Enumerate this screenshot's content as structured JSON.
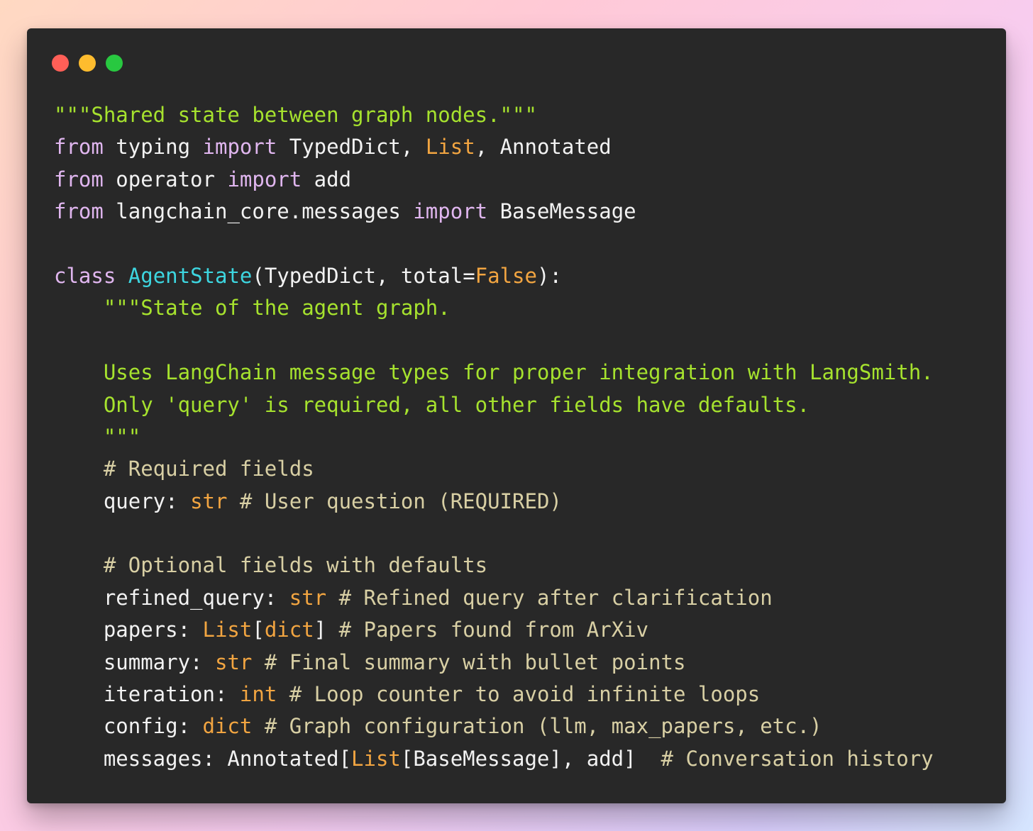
{
  "window": {
    "controls": [
      {
        "name": "close",
        "color": "#ff5f57"
      },
      {
        "name": "minimize",
        "color": "#febc2e"
      },
      {
        "name": "maximize",
        "color": "#28c840"
      }
    ]
  },
  "code": {
    "lines": [
      [
        {
          "t": "\"\"\"Shared state between graph nodes.\"\"\"",
          "c": "str"
        }
      ],
      [
        {
          "t": "from",
          "c": "kw"
        },
        {
          "t": " typing ",
          "c": "plain"
        },
        {
          "t": "import",
          "c": "kw"
        },
        {
          "t": " TypedDict, ",
          "c": "plain"
        },
        {
          "t": "List",
          "c": "const"
        },
        {
          "t": ", Annotated",
          "c": "plain"
        }
      ],
      [
        {
          "t": "from",
          "c": "kw"
        },
        {
          "t": " operator ",
          "c": "plain"
        },
        {
          "t": "import",
          "c": "kw"
        },
        {
          "t": " add",
          "c": "plain"
        }
      ],
      [
        {
          "t": "from",
          "c": "kw"
        },
        {
          "t": " langchain_core.messages ",
          "c": "plain"
        },
        {
          "t": "import",
          "c": "kw"
        },
        {
          "t": " BaseMessage",
          "c": "plain"
        }
      ],
      [],
      [
        {
          "t": "class",
          "c": "kw"
        },
        {
          "t": " ",
          "c": "plain"
        },
        {
          "t": "AgentState",
          "c": "cls"
        },
        {
          "t": "(TypedDict, total=",
          "c": "plain"
        },
        {
          "t": "False",
          "c": "const"
        },
        {
          "t": "):",
          "c": "plain"
        }
      ],
      [
        {
          "t": "    \"\"\"State of the agent graph.",
          "c": "str"
        }
      ],
      [],
      [
        {
          "t": "    Uses LangChain message types for proper integration with LangSmith.",
          "c": "str"
        }
      ],
      [
        {
          "t": "    Only 'query' is required, all other fields have defaults.",
          "c": "str"
        }
      ],
      [
        {
          "t": "    \"\"\"",
          "c": "str"
        }
      ],
      [
        {
          "t": "    # Required fields",
          "c": "cm"
        }
      ],
      [
        {
          "t": "    query: ",
          "c": "plain"
        },
        {
          "t": "str",
          "c": "const"
        },
        {
          "t": " # User question (REQUIRED)",
          "c": "cm"
        }
      ],
      [],
      [
        {
          "t": "    # Optional fields with defaults",
          "c": "cm"
        }
      ],
      [
        {
          "t": "    refined_query: ",
          "c": "plain"
        },
        {
          "t": "str",
          "c": "const"
        },
        {
          "t": " # Refined query after clarification",
          "c": "cm"
        }
      ],
      [
        {
          "t": "    papers: ",
          "c": "plain"
        },
        {
          "t": "List",
          "c": "const"
        },
        {
          "t": "[",
          "c": "plain"
        },
        {
          "t": "dict",
          "c": "const"
        },
        {
          "t": "]",
          "c": "plain"
        },
        {
          "t": " # Papers found from ArXiv",
          "c": "cm"
        }
      ],
      [
        {
          "t": "    summary: ",
          "c": "plain"
        },
        {
          "t": "str",
          "c": "const"
        },
        {
          "t": " # Final summary with bullet points",
          "c": "cm"
        }
      ],
      [
        {
          "t": "    iteration: ",
          "c": "plain"
        },
        {
          "t": "int",
          "c": "const"
        },
        {
          "t": " # Loop counter to avoid infinite loops",
          "c": "cm"
        }
      ],
      [
        {
          "t": "    config: ",
          "c": "plain"
        },
        {
          "t": "dict",
          "c": "const"
        },
        {
          "t": " # Graph configuration (llm, max_papers, etc.)",
          "c": "cm"
        }
      ],
      [
        {
          "t": "    messages: Annotated[",
          "c": "plain"
        },
        {
          "t": "List",
          "c": "const"
        },
        {
          "t": "[BaseMessage], add]  ",
          "c": "plain"
        },
        {
          "t": "# Conversation history",
          "c": "cm"
        }
      ]
    ]
  }
}
